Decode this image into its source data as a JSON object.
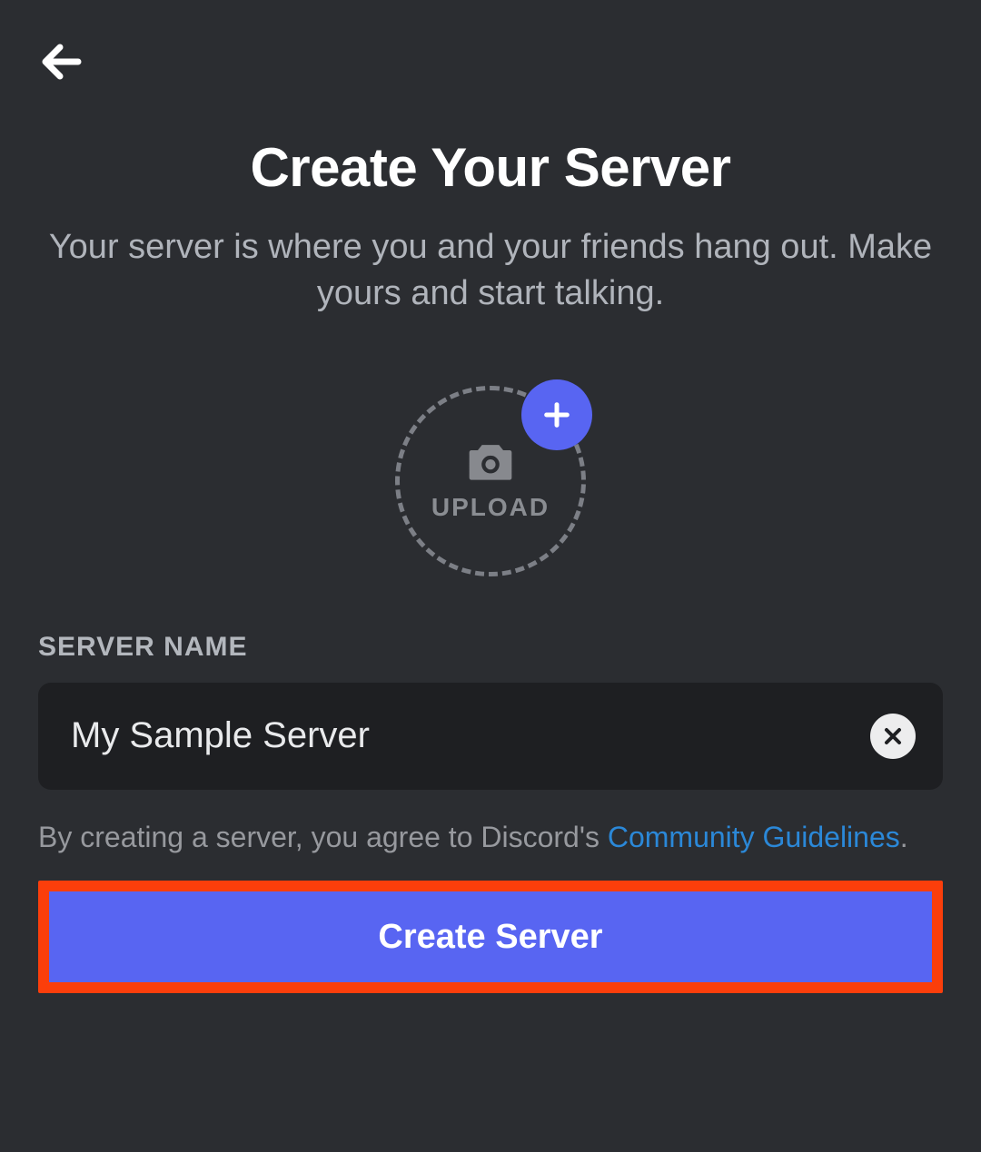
{
  "header": {
    "title": "Create Your Server",
    "subtitle": "Your server is where you and your friends hang out. Make yours and start talking."
  },
  "upload": {
    "label": "UPLOAD"
  },
  "form": {
    "server_name_label": "SERVER NAME",
    "server_name_value": "My Sample Server"
  },
  "disclaimer": {
    "prefix": "By creating a server, you agree to Discord's ",
    "link_text": "Community Guidelines",
    "suffix": "."
  },
  "actions": {
    "create_label": "Create Server"
  },
  "icons": {
    "back": "arrow-left-icon",
    "camera": "camera-icon",
    "plus": "plus-icon",
    "clear": "close-icon"
  },
  "colors": {
    "accent": "#5865f2",
    "highlight_border": "#fb3e0b",
    "link": "#2b88d8",
    "bg": "#2b2d31",
    "input_bg": "#1e1f22"
  }
}
